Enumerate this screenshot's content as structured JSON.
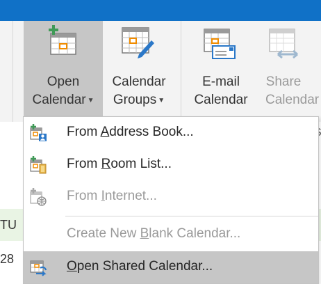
{
  "ribbon": {
    "open_calendar": {
      "line1": "Open",
      "line2": "Calendar"
    },
    "calendar_groups": {
      "line1": "Calendar",
      "line2": "Groups"
    },
    "email_calendar": {
      "line1": "E-mail",
      "line2": "Calendar"
    },
    "share_calendar": {
      "line1": "Share",
      "line2": "Calendar"
    },
    "group_label_partial": "S"
  },
  "background": {
    "partial_right_text": "se",
    "partial_left_1": "TU",
    "partial_left_2": "28"
  },
  "menu": {
    "items": [
      {
        "pre": "From ",
        "acc": "A",
        "post": "ddress Book...",
        "enabled": true,
        "icon": "address-book-icon"
      },
      {
        "pre": "From ",
        "acc": "R",
        "post": "oom List...",
        "enabled": true,
        "icon": "room-list-icon"
      },
      {
        "pre": "From ",
        "acc": "I",
        "post": "nternet...",
        "enabled": false,
        "icon": "internet-calendar-icon"
      },
      {
        "pre": "Create New ",
        "acc": "B",
        "post": "lank Calendar...",
        "enabled": false,
        "icon": ""
      },
      {
        "pre": "",
        "acc": "O",
        "post": "pen Shared Calendar...",
        "enabled": true,
        "icon": "shared-calendar-icon",
        "highlighted": true
      }
    ]
  },
  "colors": {
    "titlebar": "#1071c7",
    "ribbon_bg": "#f3f3f3",
    "pressed": "#c6c6c6",
    "accent_orange": "#f08c00",
    "accent_blue": "#2b78c8",
    "accent_green": "#3f9a57"
  }
}
